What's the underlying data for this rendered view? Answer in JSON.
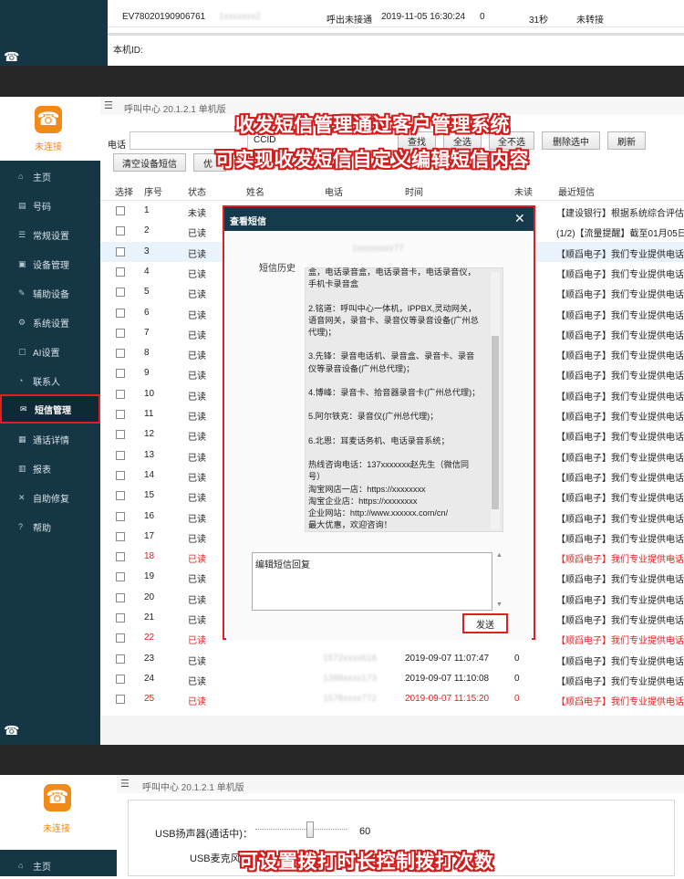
{
  "top_panel": {
    "row": {
      "id": "EV78020190906761",
      "phone": "1xxxxxxx2",
      "status": "呼出未接通",
      "time": "2019-11-05 16:30:24",
      "unread": "0",
      "duration": "31秒",
      "transfer": "未转接"
    },
    "local_id_label": "本机ID:"
  },
  "app": {
    "title": "呼叫中心  20.1.2.1  单机版",
    "connection_status": "未连接",
    "phone_label": "电话",
    "ccid_label": "CCID",
    "buttons": {
      "find": "查找",
      "select_all": "全选",
      "deselect_all": "全不选",
      "delete_selected": "删除选中",
      "refresh": "刷新",
      "clear_device_sms": "清空设备短信",
      "prefs": "优"
    }
  },
  "sidebar": {
    "items": [
      {
        "label": "主页",
        "icon": "home-icon"
      },
      {
        "label": "号码",
        "icon": "contact-card-icon"
      },
      {
        "label": "常规设置",
        "icon": "sliders-icon"
      },
      {
        "label": "设备管理",
        "icon": "device-icon"
      },
      {
        "label": "辅助设备",
        "icon": "wrench-icon"
      },
      {
        "label": "系统设置",
        "icon": "gear-icon"
      },
      {
        "label": "AI设置",
        "icon": "ai-icon"
      },
      {
        "label": "联系人",
        "icon": "person-icon"
      },
      {
        "label": "短信管理",
        "icon": "message-icon"
      },
      {
        "label": "通话详情",
        "icon": "call-detail-icon"
      },
      {
        "label": "报表",
        "icon": "chart-icon"
      },
      {
        "label": "自助修复",
        "icon": "tools-icon"
      },
      {
        "label": "帮助",
        "icon": "help-icon"
      }
    ]
  },
  "table": {
    "headers": [
      "选择",
      "序号",
      "状态",
      "姓名",
      "电话",
      "时间",
      "未读",
      "最近短信"
    ],
    "rows": [
      {
        "no": "1",
        "status": "未读",
        "sms": "【建设银行】根据系统综合评估结"
      },
      {
        "no": "2",
        "status": "已读",
        "sms": "(1/2)【流量提醒】截至01月05日"
      },
      {
        "no": "3",
        "status": "已读",
        "sms": "【顺舀电子】我们专业提供电话录"
      },
      {
        "no": "4",
        "status": "已读",
        "sms": "【顺舀电子】我们专业提供电话录"
      },
      {
        "no": "5",
        "status": "已读",
        "sms": "【顺舀电子】我们专业提供电话录"
      },
      {
        "no": "6",
        "status": "已读",
        "sms": "【顺舀电子】我们专业提供电话录"
      },
      {
        "no": "7",
        "status": "已读",
        "sms": "【顺舀电子】我们专业提供电话录"
      },
      {
        "no": "8",
        "status": "已读",
        "sms": "【顺舀电子】我们专业提供电话录"
      },
      {
        "no": "9",
        "status": "已读",
        "sms": "【顺舀电子】我们专业提供电话录"
      },
      {
        "no": "10",
        "status": "已读",
        "sms": "【顺舀电子】我们专业提供电话录"
      },
      {
        "no": "11",
        "status": "已读",
        "sms": "【顺舀电子】我们专业提供电话录"
      },
      {
        "no": "12",
        "status": "已读",
        "sms": "【顺舀电子】我们专业提供电话录"
      },
      {
        "no": "13",
        "status": "已读",
        "sms": "【顺舀电子】我们专业提供电话录"
      },
      {
        "no": "14",
        "status": "已读",
        "sms": "【顺舀电子】我们专业提供电话录"
      },
      {
        "no": "15",
        "status": "已读",
        "sms": "【顺舀电子】我们专业提供电话录"
      },
      {
        "no": "16",
        "status": "已读",
        "sms": "【顺舀电子】我们专业提供电话录"
      },
      {
        "no": "17",
        "status": "已读",
        "sms": "【顺舀电子】我们专业提供电话录"
      },
      {
        "no": "18",
        "status": "已读",
        "sms": "【顺舀电子】我们专业提供电话录"
      },
      {
        "no": "19",
        "status": "已读",
        "sms": "【顺舀电子】我们专业提供电话录"
      },
      {
        "no": "20",
        "status": "已读",
        "sms": "【顺舀电子】我们专业提供电话录"
      },
      {
        "no": "21",
        "status": "已读",
        "sms": "【顺舀电子】我们专业提供电话录"
      },
      {
        "no": "22",
        "status": "已读",
        "sms": "【顺舀电子】我们专业提供电话录"
      },
      {
        "no": "23",
        "status": "已读",
        "phone": "1572xxxx618",
        "time": "2019-09-07 11:07:47",
        "unread": "0",
        "sms": "【顺舀电子】我们专业提供电话录"
      },
      {
        "no": "24",
        "status": "已读",
        "phone": "1388xxxx173",
        "time": "2019-09-07 11:10:08",
        "unread": "0",
        "sms": "【顺舀电子】我们专业提供电话录"
      },
      {
        "no": "25",
        "status": "已读",
        "phone": "1578xxxx772",
        "time": "2019-09-07 11:15:20",
        "unread": "0",
        "sms": "【顺舀电子】我们专业提供电话录"
      }
    ],
    "red_rows": [
      18,
      22,
      25
    ]
  },
  "dialog": {
    "title": "查看短信",
    "close_glyph": "✕",
    "phone": "1xxxxxxxx77",
    "history_label": "短信历史",
    "history_text": "盒，电话录音盒，电话录音卡，电话录音仪，\n手机卡录音盒\n\n2.铭道：呼叫中心一体机，IPPBX,灵动网关，\n语音网关，录音卡、录音仪等录音设备(广州总\n代理)；\n\n3.先锋：录音电话机、录音盒、录音卡、录音\n仪等录音设备(广州总代理)；\n\n4.博峰：录音卡、拾音器录音卡(广州总代理)；\n\n5.阿尔铁克：录音仪(广州总代理)；\n\n6.北恩：耳麦话务机、电话录音系统；\n\n热线咨询电话：137xxxxxxx赵先生（微信同\n号）\n淘宝网店一店：https://xxxxxxxx\n淘宝企业店：https://xxxxxxxx\n企业网站：http://www.xxxxxx.com/cn/\n最大优惠，欢迎咨询！",
    "reply_text": "编辑短信回复",
    "send_label": "发送"
  },
  "captions": {
    "line1": "收发短信管理通过客户管理系统",
    "line2": "可实现收发短信自定义编辑短信内容",
    "line3": "可设置拨打时长控制拨打次数"
  },
  "bottom_panel": {
    "title": "呼叫中心  20.1.2.1  单机版",
    "status": "未连接",
    "home_label": "主页",
    "speaker_label": "USB扬声器(通话中)：",
    "speaker_value": "60",
    "speaker_level": 0.6,
    "mic_label": "USB麦克风"
  },
  "colors": {
    "sidebar": "#143645",
    "accent_red": "#e02020",
    "logo_orange": "#f08a18",
    "dialog_header": "#143a4c",
    "band": "#262626"
  }
}
